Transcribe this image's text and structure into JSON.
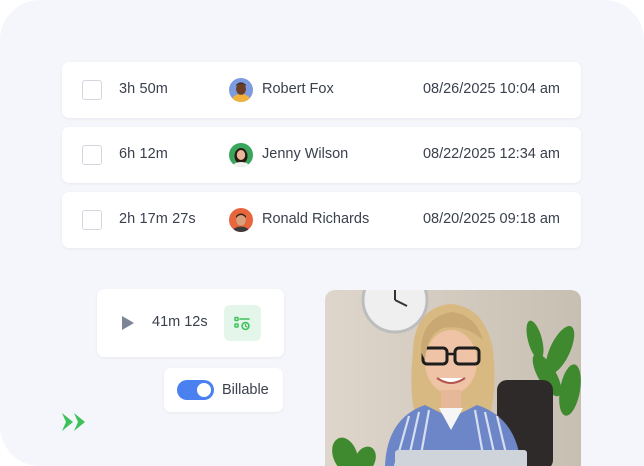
{
  "entries": [
    {
      "duration": "3h 50m",
      "user": "Robert Fox",
      "timestamp": "08/26/2025 10:04 am",
      "avatar_color": "#6b8fd6"
    },
    {
      "duration": "6h 12m",
      "user": "Jenny Wilson",
      "timestamp": "08/22/2025 12:34 am",
      "avatar_color": "#3aa55c"
    },
    {
      "duration": "2h 17m 27s",
      "user": "Ronald Richards",
      "timestamp": "08/20/2025 09:18 am",
      "avatar_color": "#e8663d"
    }
  ],
  "timer": {
    "elapsed": "41m 12s",
    "play_icon": "play-icon",
    "project_icon": "project-list-icon"
  },
  "billable": {
    "label": "Billable",
    "enabled": true
  },
  "colors": {
    "accent": "#4a80ef",
    "brand_green": "#3dc15a",
    "background": "#f4f6fb"
  }
}
